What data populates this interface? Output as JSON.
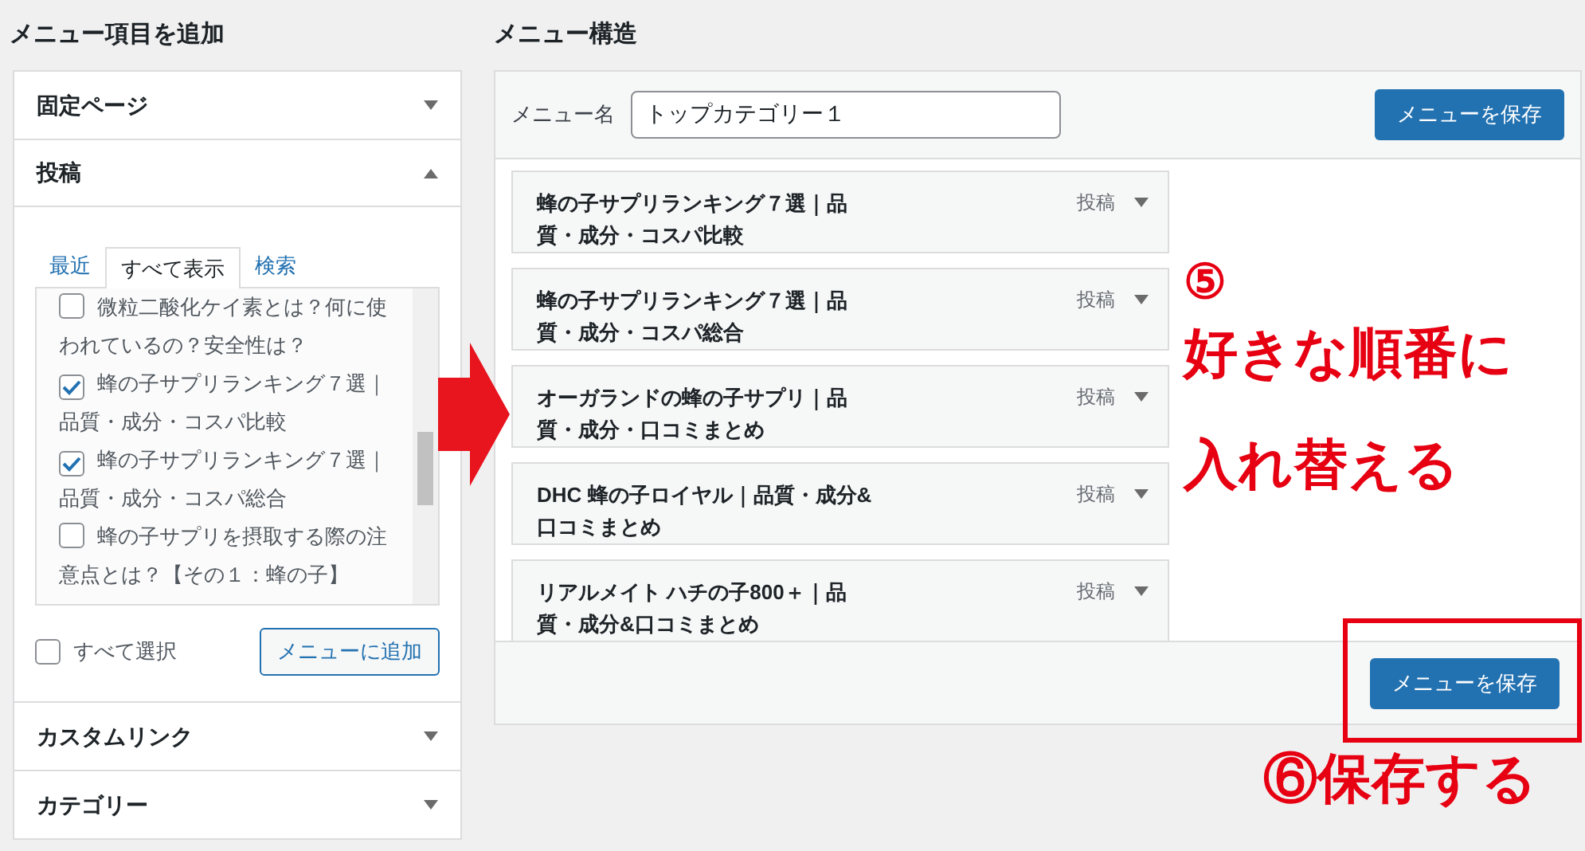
{
  "left_panel": {
    "title": "メニュー項目を追加",
    "sections": [
      {
        "title": "固定ページ",
        "expanded": false
      },
      {
        "title": "投稿",
        "expanded": true,
        "tabs": [
          {
            "label": "最近",
            "selected": false
          },
          {
            "label": "すべて表示",
            "selected": true
          },
          {
            "label": "検索",
            "selected": false
          }
        ],
        "items": [
          {
            "label": "微粒二酸化ケイ素とは？何に使われているの？安全性は？",
            "checked": false
          },
          {
            "label": "蜂の子サプリランキング７選｜品質・成分・コスパ比較",
            "checked": true
          },
          {
            "label": "蜂の子サプリランキング７選｜品質・成分・コスパ総合",
            "checked": true
          },
          {
            "label": "蜂の子サプリを摂取する際の注意点とは？【その１：蜂の子】",
            "checked": false
          }
        ],
        "select_all": {
          "label": "すべて選択",
          "checked": false
        },
        "add_button": "メニューに追加"
      },
      {
        "title": "カスタムリンク",
        "expanded": false
      },
      {
        "title": "カテゴリー",
        "expanded": false
      }
    ]
  },
  "right_panel": {
    "title": "メニュー構造",
    "menu_name_label": "メニュー名",
    "menu_name_value": "トップカテゴリー１",
    "save_button": "メニューを保存",
    "items": [
      {
        "title": "蜂の子サプリランキング７選｜品質・成分・コスパ比較",
        "type": "投稿"
      },
      {
        "title": "蜂の子サプリランキング７選｜品質・成分・コスパ総合",
        "type": "投稿"
      },
      {
        "title": "オーガランドの蜂の子サプリ｜品質・成分・口コミまとめ",
        "type": "投稿"
      },
      {
        "title": "DHC 蜂の子ロイヤル｜品質・成分&口コミまとめ",
        "type": "投稿"
      },
      {
        "title": "リアルメイト ハチの子800＋｜品質・成分&口コミまとめ",
        "type": "投稿"
      }
    ],
    "footer_save_button": "メニューを保存"
  },
  "step5": {
    "number": "⑤",
    "lines": [
      "好きな順番に",
      "入れ替える"
    ]
  },
  "step6": {
    "text": "⑥保存する"
  }
}
